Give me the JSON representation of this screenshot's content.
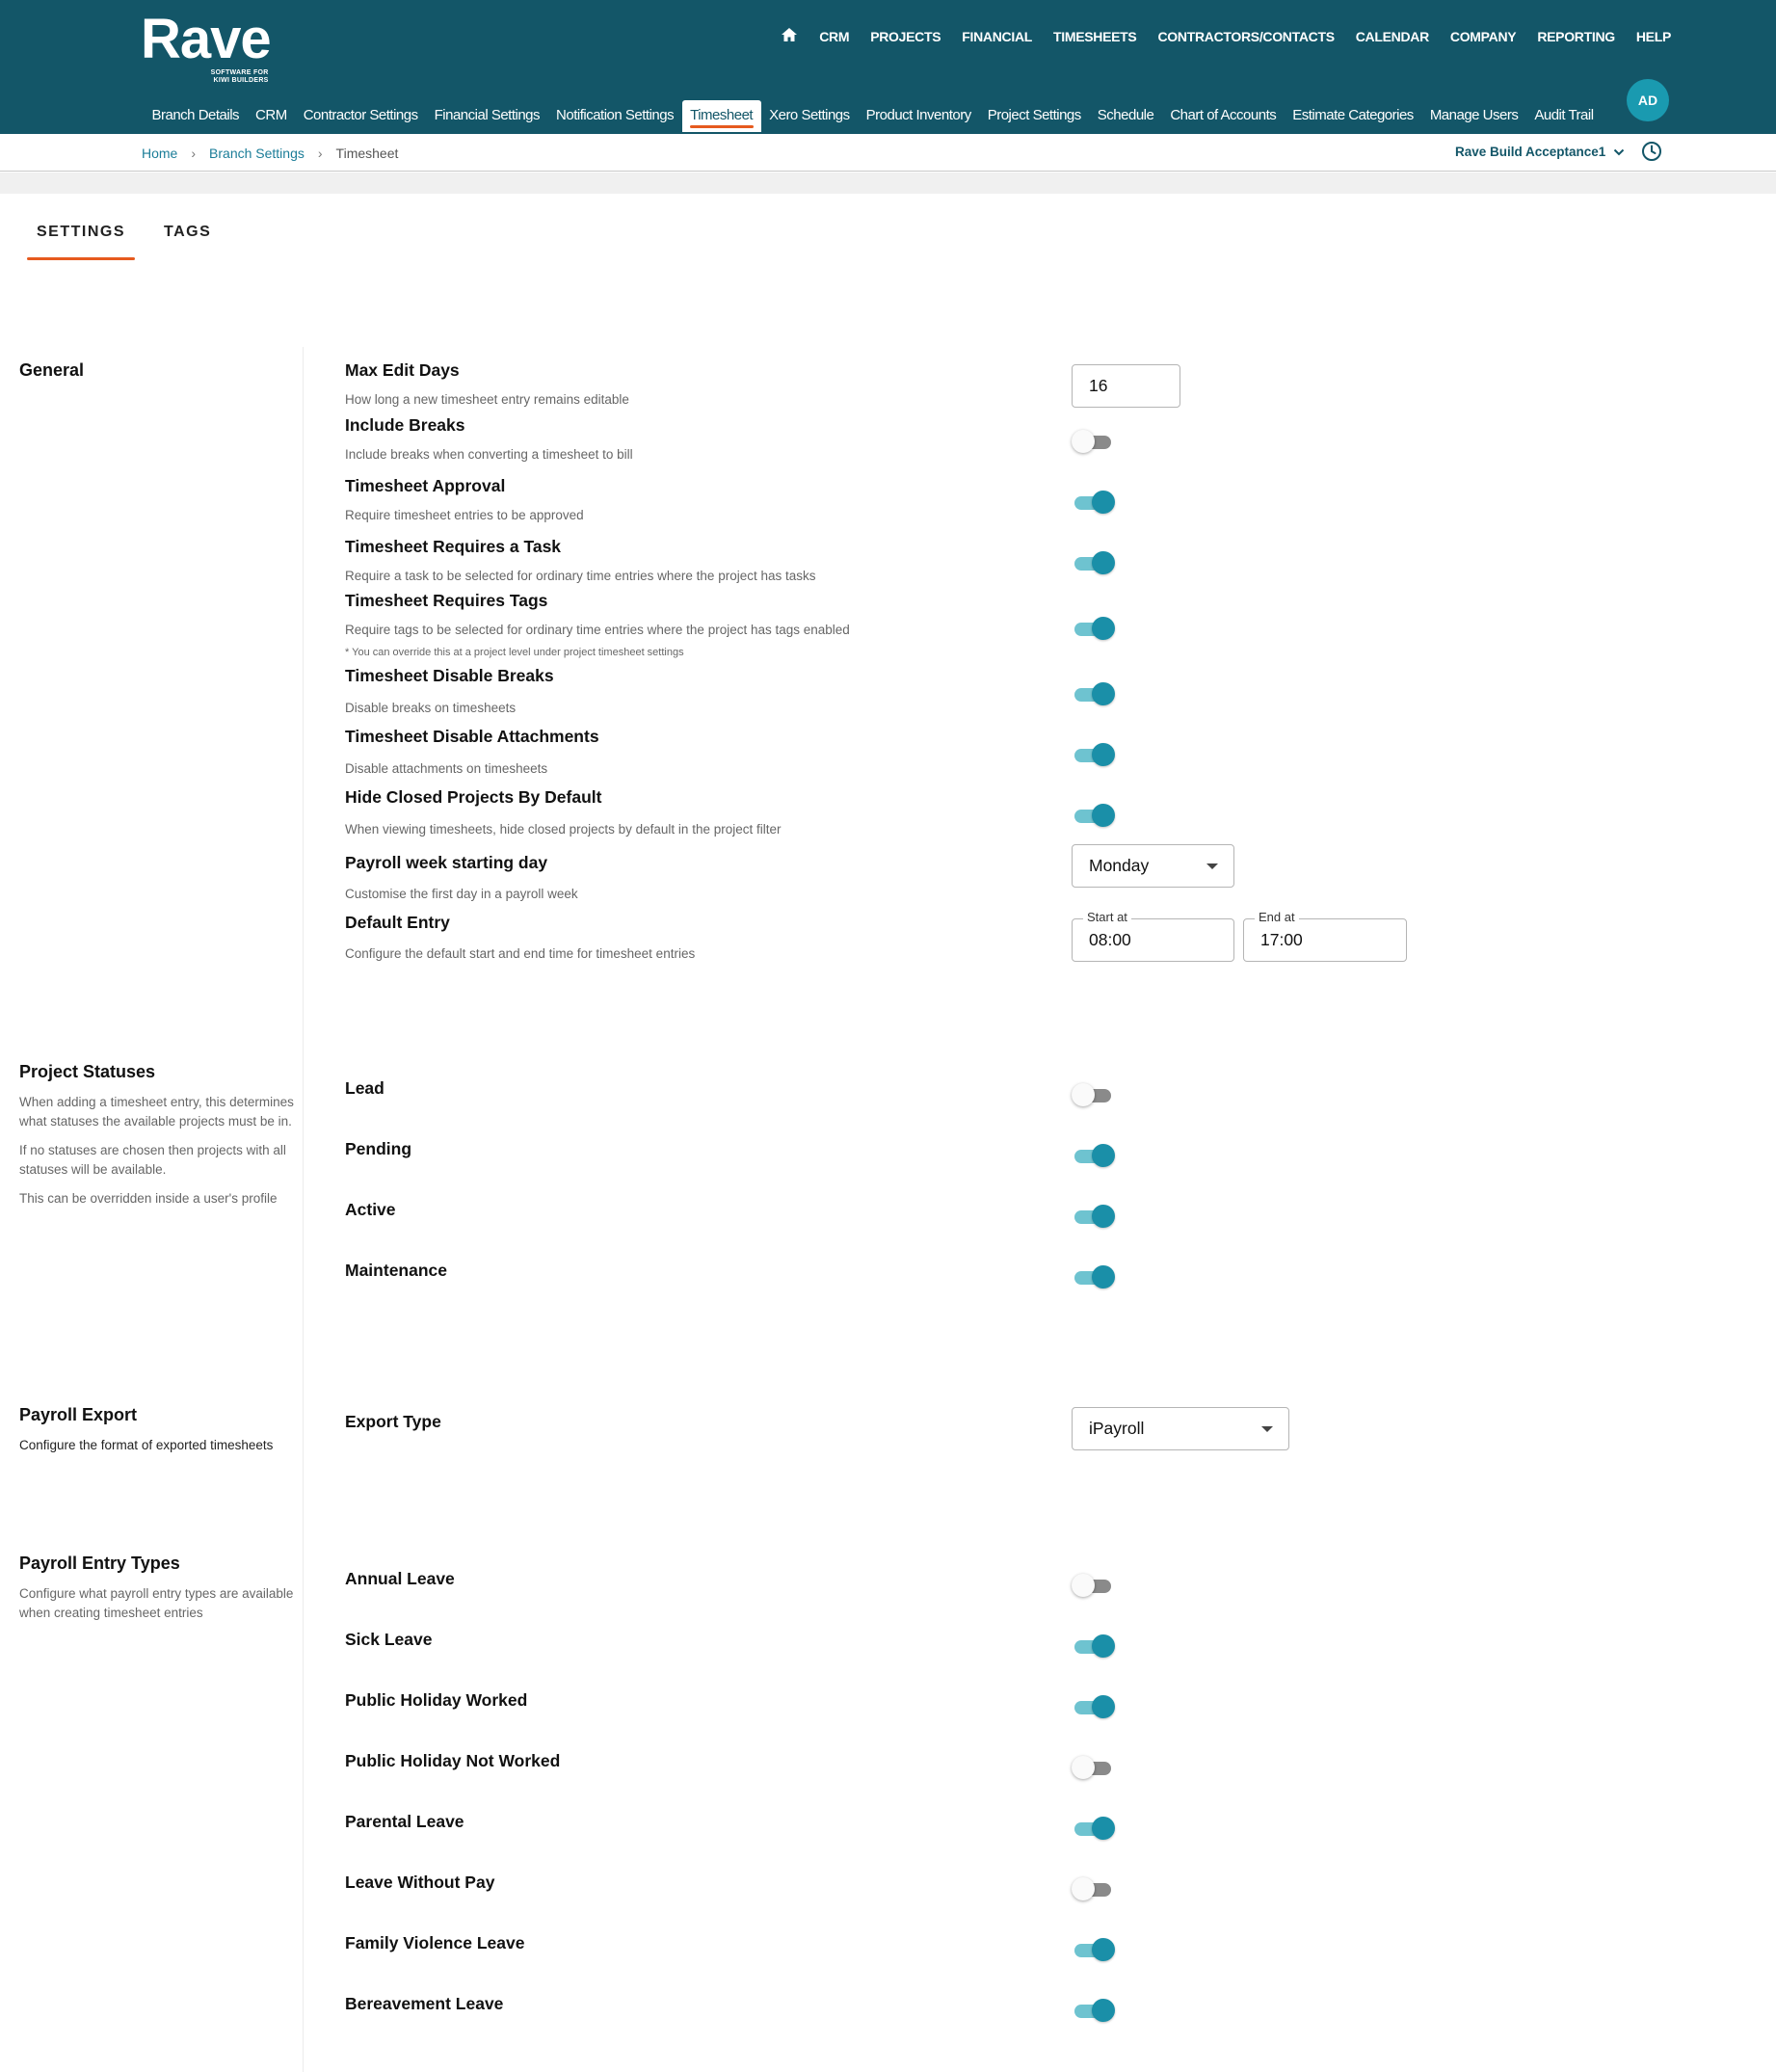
{
  "brand": {
    "name": "Rave",
    "tagline_line1": "SOFTWARE FOR",
    "tagline_line2": "KIWI BUILDERS"
  },
  "top_nav": [
    "CRM",
    "PROJECTS",
    "FINANCIAL",
    "TIMESHEETS",
    "CONTRACTORS/CONTACTS",
    "CALENDAR",
    "COMPANY",
    "REPORTING",
    "HELP"
  ],
  "sub_nav": [
    "Branch Details",
    "CRM",
    "Contractor Settings",
    "Financial Settings",
    "Notification Settings",
    "Timesheet",
    "Xero Settings",
    "Product Inventory",
    "Project Settings",
    "Schedule",
    "Chart of Accounts",
    "Estimate Categories",
    "Manage Users",
    "Audit Trail"
  ],
  "sub_nav_active": "Timesheet",
  "user": {
    "initials": "AD"
  },
  "breadcrumb": [
    "Home",
    "Branch Settings",
    "Timesheet"
  ],
  "branch_selector": "Rave Build Acceptance1",
  "tabs": [
    "SETTINGS",
    "TAGS"
  ],
  "active_tab": "SETTINGS",
  "general": {
    "title": "General",
    "max_edit_days": {
      "title": "Max Edit Days",
      "desc": "How long a new timesheet entry remains editable",
      "value": "16"
    },
    "toggles": [
      {
        "title": "Include Breaks",
        "desc": "Include breaks when converting a timesheet to bill",
        "on": false
      },
      {
        "title": "Timesheet Approval",
        "desc": "Require timesheet entries to be approved",
        "on": true
      },
      {
        "title": "Timesheet Requires a Task",
        "desc": "Require a task to be selected for ordinary time entries where the project has tasks",
        "on": true
      },
      {
        "title": "Timesheet Requires Tags",
        "desc": "Require tags to be selected for ordinary time entries where the project has tags enabled",
        "note": "* You can override this at a project level under project timesheet settings",
        "on": true
      },
      {
        "title": "Timesheet Disable Breaks",
        "desc": "Disable breaks on timesheets",
        "on": true
      },
      {
        "title": "Timesheet Disable Attachments",
        "desc": "Disable attachments on timesheets",
        "on": true
      },
      {
        "title": "Hide Closed Projects By Default",
        "desc": "When viewing timesheets, hide closed projects by default in the project filter",
        "on": true
      }
    ],
    "payroll_week": {
      "title": "Payroll week starting day",
      "desc": "Customise the first day in a payroll week",
      "value": "Monday"
    },
    "default_entry": {
      "title": "Default Entry",
      "desc": "Configure the default start and end time for timesheet entries",
      "start_label": "Start at",
      "start_value": "08:00",
      "end_label": "End at",
      "end_value": "17:00"
    }
  },
  "project_statuses": {
    "title": "Project Statuses",
    "desc1": "When adding a timesheet entry, this determines what statuses the available projects must be in.",
    "desc2": "If no statuses are chosen then projects with all statuses will be available.",
    "desc3": "This can be overridden inside a user's profile",
    "items": [
      {
        "label": "Lead",
        "on": false
      },
      {
        "label": "Pending",
        "on": true
      },
      {
        "label": "Active",
        "on": true
      },
      {
        "label": "Maintenance",
        "on": true
      }
    ]
  },
  "payroll_export": {
    "title": "Payroll Export",
    "desc": "Configure the format of exported timesheets",
    "export_type_label": "Export Type",
    "export_type_value": "iPayroll"
  },
  "payroll_entry_types": {
    "title": "Payroll Entry Types",
    "desc": "Configure what payroll entry types are available when creating timesheet entries",
    "items": [
      {
        "label": "Annual Leave",
        "on": false
      },
      {
        "label": "Sick Leave",
        "on": true
      },
      {
        "label": "Public Holiday Worked",
        "on": true
      },
      {
        "label": "Public Holiday Not Worked",
        "on": false
      },
      {
        "label": "Parental Leave",
        "on": true
      },
      {
        "label": "Leave Without Pay",
        "on": false
      },
      {
        "label": "Family Violence Leave",
        "on": true
      },
      {
        "label": "Bereavement Leave",
        "on": true
      }
    ]
  },
  "colors": {
    "header": "#135668",
    "accent": "#e65a1e",
    "toggle_on": "#1a8fa8",
    "link": "#1b7d98"
  }
}
